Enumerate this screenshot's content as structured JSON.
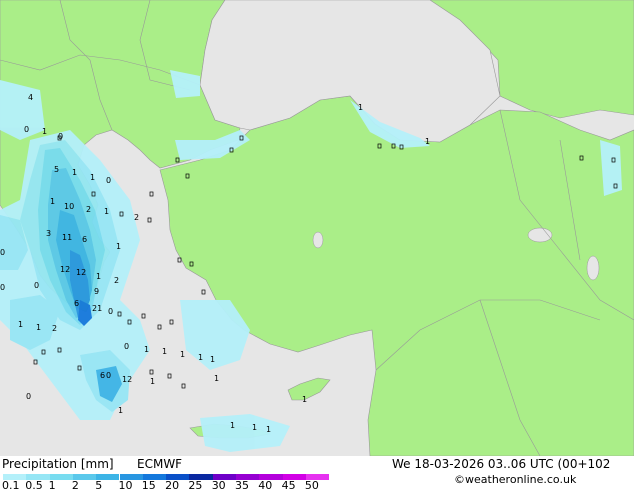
{
  "footer": {
    "title": "Precipitation [mm]",
    "model": "ECMWF",
    "datetime": "We 18-03-2026 03..06 UTC (00+102",
    "credit": "©weatheronline.co.uk"
  },
  "legend": {
    "ticks": [
      "0.1",
      "0.5",
      "1",
      "2",
      "5",
      "10",
      "15",
      "20",
      "25",
      "30",
      "35",
      "40",
      "45",
      "50"
    ],
    "colors": [
      "#b4f0fa",
      "#96e6f5",
      "#78dcf0",
      "#5ac8eb",
      "#3cb4e6",
      "#2896e1",
      "#1478dc",
      "#0a50c8",
      "#0a28a0",
      "#6e00c8",
      "#9600d2",
      "#b400dc",
      "#d200e6",
      "#e632f0"
    ]
  },
  "map": {
    "land_color": "#aaee88",
    "sea_color": "#e6e6e6",
    "labels": [
      {
        "t": "4"
      },
      {
        "t": "0"
      },
      {
        "t": "1"
      },
      {
        "t": "0"
      },
      {
        "t": "5"
      },
      {
        "t": "1"
      },
      {
        "t": "1"
      },
      {
        "t": "0"
      },
      {
        "t": "1"
      },
      {
        "t": "10"
      },
      {
        "t": "2"
      },
      {
        "t": "1"
      },
      {
        "t": "2"
      },
      {
        "t": "3"
      },
      {
        "t": "11"
      },
      {
        "t": "6"
      },
      {
        "t": "1"
      },
      {
        "t": "12"
      },
      {
        "t": "12"
      },
      {
        "t": "1"
      },
      {
        "t": "2"
      },
      {
        "t": "9"
      },
      {
        "t": "6"
      },
      {
        "t": "21"
      },
      {
        "t": "0"
      },
      {
        "t": "1"
      },
      {
        "t": "1"
      },
      {
        "t": "2"
      },
      {
        "t": "1"
      },
      {
        "t": "0"
      },
      {
        "t": "1"
      },
      {
        "t": "1"
      },
      {
        "t": "1"
      },
      {
        "t": "0"
      },
      {
        "t": "6"
      },
      {
        "t": "12"
      },
      {
        "t": "0"
      },
      {
        "t": "1"
      },
      {
        "t": "1"
      },
      {
        "t": "1"
      },
      {
        "t": "1"
      },
      {
        "t": "1"
      },
      {
        "t": "1"
      },
      {
        "t": "1"
      },
      {
        "t": "1"
      },
      {
        "t": "0"
      },
      {
        "t": "0"
      },
      {
        "t": "0"
      },
      {
        "t": "1"
      },
      {
        "t": "1"
      }
    ]
  }
}
